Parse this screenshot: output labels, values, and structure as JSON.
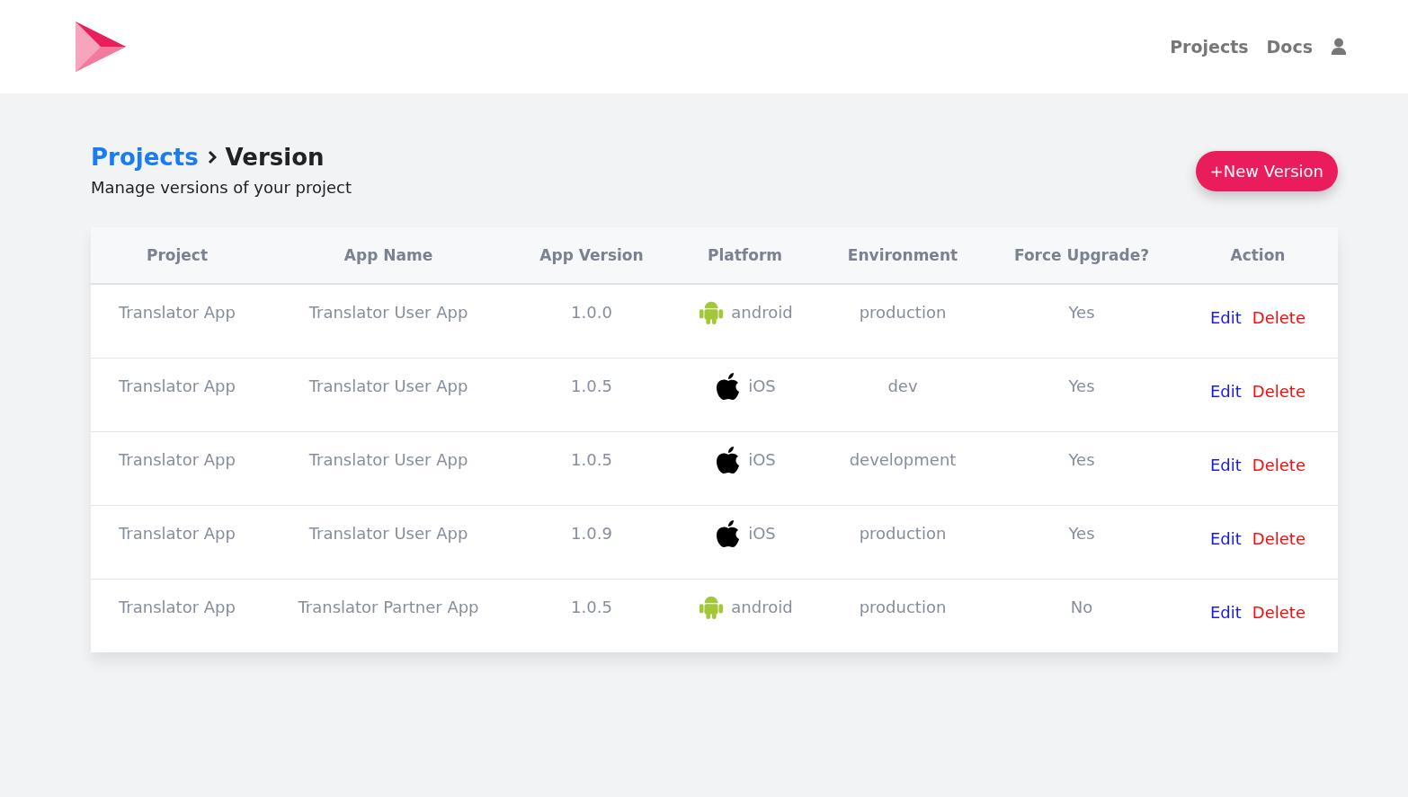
{
  "nav": {
    "links": [
      "Projects",
      "Docs"
    ]
  },
  "header": {
    "breadcrumb": [
      "Projects",
      "Version"
    ],
    "subtitle": "Manage versions of your project",
    "new_button": "+New Version"
  },
  "table": {
    "columns": [
      "Project",
      "App Name",
      "App Version",
      "Platform",
      "Environment",
      "Force Upgrade?",
      "Action"
    ],
    "rows": [
      {
        "project": "Translator App",
        "app_name": "Translator User App",
        "version": "1.0.0",
        "platform": {
          "kind": "android",
          "label": "android"
        },
        "environment": "production",
        "force_upgrade": "Yes",
        "actions": [
          "Edit",
          "Delete"
        ]
      },
      {
        "project": "Translator App",
        "app_name": "Translator User App",
        "version": "1.0.5",
        "platform": {
          "kind": "ios",
          "label": "iOS"
        },
        "environment": "dev",
        "force_upgrade": "Yes",
        "actions": [
          "Edit",
          "Delete"
        ]
      },
      {
        "project": "Translator App",
        "app_name": "Translator User App",
        "version": "1.0.5",
        "platform": {
          "kind": "ios",
          "label": "iOS"
        },
        "environment": "development",
        "force_upgrade": "Yes",
        "actions": [
          "Edit",
          "Delete"
        ]
      },
      {
        "project": "Translator App",
        "app_name": "Translator User App",
        "version": "1.0.9",
        "platform": {
          "kind": "ios",
          "label": "iOS"
        },
        "environment": "production",
        "force_upgrade": "Yes",
        "actions": [
          "Edit",
          "Delete"
        ]
      },
      {
        "project": "Translator App",
        "app_name": "Translator Partner App",
        "version": "1.0.5",
        "platform": {
          "kind": "android",
          "label": "android"
        },
        "environment": "production",
        "force_upgrade": "No",
        "actions": [
          "Edit",
          "Delete"
        ]
      }
    ]
  }
}
